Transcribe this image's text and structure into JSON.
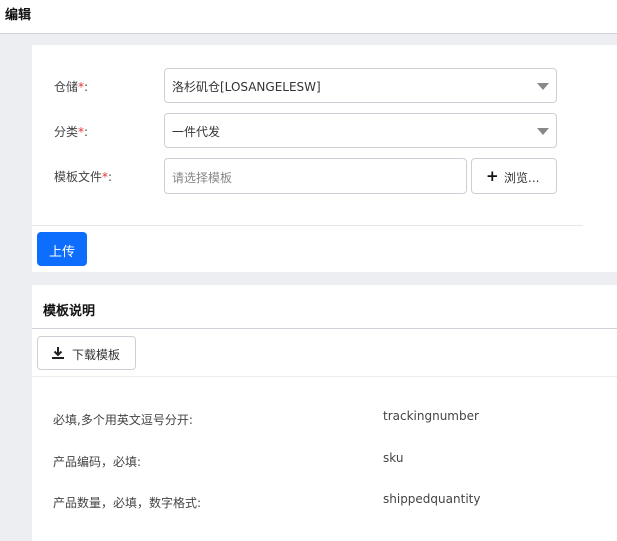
{
  "header": {
    "title": "编辑"
  },
  "form": {
    "warehouse": {
      "label": "仓储",
      "required_mark": "*",
      "colon": ":",
      "value": "洛杉矶仓[LOSANGELESW]"
    },
    "category": {
      "label": "分类",
      "required_mark": "*",
      "colon": ":",
      "value": "一件代发"
    },
    "template_file": {
      "label": "模板文件",
      "required_mark": "*",
      "colon": ":",
      "placeholder": "请选择模板",
      "browse_label": "浏览..."
    },
    "upload_label": "上传"
  },
  "template_info": {
    "title": "模板说明",
    "download_label": "下载模板",
    "fields": [
      {
        "desc": "必填,多个用英文逗号分开:",
        "name": "trackingnumber"
      },
      {
        "desc": "产品编码，必填:",
        "name": "sku"
      },
      {
        "desc": "产品数量，必填，数字格式:",
        "name": "shippedquantity"
      }
    ]
  },
  "colors": {
    "primary": "#0d6efd",
    "required": "#e0342f",
    "background": "#eceef2"
  },
  "icons": {
    "browse": "plus-icon",
    "download": "download-icon",
    "dropdown": "caret-down-icon"
  }
}
